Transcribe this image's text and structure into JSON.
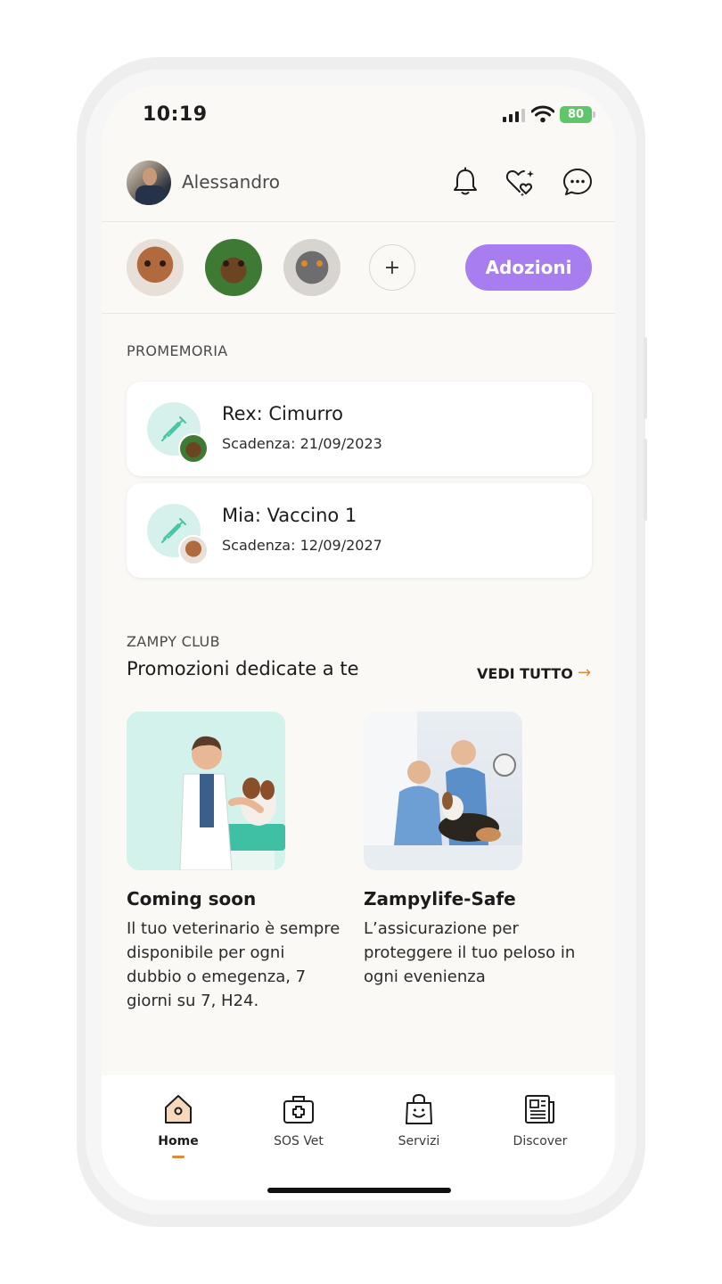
{
  "status_bar": {
    "time": "10:19",
    "battery": "80"
  },
  "header": {
    "username": "Alessandro"
  },
  "pets": {
    "items": [
      "poodle",
      "german-shepherd",
      "cat"
    ],
    "add_label": "+",
    "adoptions_button": "Adozioni"
  },
  "reminders": {
    "section_label": "PROMEMORIA",
    "items": [
      {
        "title": "Rex: Cimurro",
        "deadline": "Scadenza: 21/09/2023"
      },
      {
        "title": "Mia: Vaccino 1",
        "deadline": "Scadenza: 12/09/2027"
      }
    ]
  },
  "club": {
    "section_label": "ZAMPY CLUB",
    "title": "Promozioni dedicate a te",
    "see_all": "VEDI TUTTO",
    "see_all_arrow": "→",
    "promos": [
      {
        "title": "Coming soon",
        "description": "Il tuo veterinario è sempre disponibile per ogni dubbio o emegenza, 7 giorni su 7, H24."
      },
      {
        "title": "Zampylife-Safe",
        "description": "L’assicurazione per proteggere il tuo peloso in ogni evenienza"
      }
    ]
  },
  "nav": {
    "items": [
      {
        "label": "Home",
        "icon": "home-icon",
        "active": true
      },
      {
        "label": "SOS Vet",
        "icon": "medical-kit-icon"
      },
      {
        "label": "Servizi",
        "icon": "shopping-bag-icon"
      },
      {
        "label": "Discover",
        "icon": "newspaper-icon"
      }
    ]
  },
  "colors": {
    "accent": "#a87df0",
    "highlight": "#e0893a",
    "mint": "#d6f1ec",
    "syringe": "#4cc3a5"
  }
}
